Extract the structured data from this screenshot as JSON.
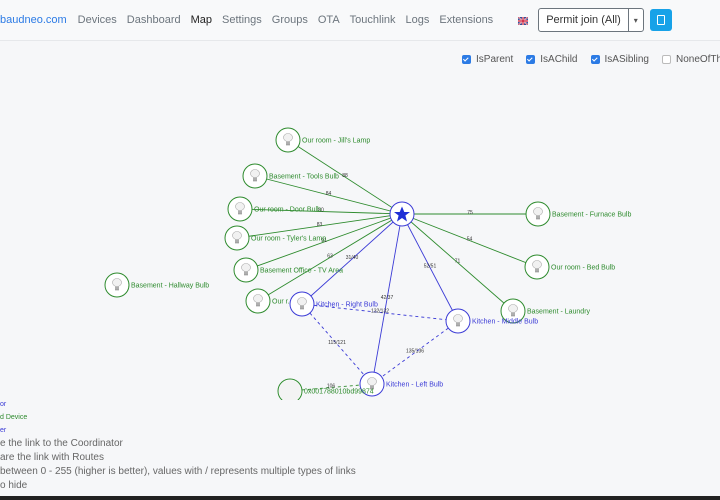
{
  "nav": {
    "brand": "baudneo.com",
    "links": [
      "Devices",
      "Dashboard",
      "Map",
      "Settings",
      "Groups",
      "OTA",
      "Touchlink",
      "Logs",
      "Extensions"
    ],
    "active": "Map",
    "permit_join_label": "Permit join (All)"
  },
  "filters": [
    {
      "label": "IsParent",
      "checked": true
    },
    {
      "label": "IsAChild",
      "checked": true
    },
    {
      "label": "IsASibling",
      "checked": true
    },
    {
      "label": "NoneOfTheAbove",
      "checked": false
    }
  ],
  "colors": {
    "green": "#2e8b2e",
    "blue": "#3b3bd6",
    "brand": "#2c7be5",
    "accent_button": "#17a2e8"
  },
  "map": {
    "coordinator": {
      "label": ""
    },
    "nodes": [
      {
        "id": "jills-lamp",
        "label": "Our room - Jill's Lamp",
        "color": "green",
        "icon": "bulb-icon"
      },
      {
        "id": "tools-bulb",
        "label": "Basement - Tools Bulb",
        "color": "green",
        "icon": "bulb-icon"
      },
      {
        "id": "door-bulb",
        "label": "Our room - Door Bulb",
        "color": "green",
        "icon": "bulb-icon"
      },
      {
        "id": "tylers-lamp",
        "label": "Our room - Tyler's Lamp",
        "color": "green",
        "icon": "bulb-icon"
      },
      {
        "id": "tv-area",
        "label": "Basement Office - TV Area",
        "color": "green",
        "icon": "bulb-icon"
      },
      {
        "id": "our-room-4",
        "label": "Our r...",
        "color": "green",
        "icon": "bulb-icon"
      },
      {
        "id": "hallway-bulb",
        "label": "Basement - Hallway Bulb",
        "color": "green",
        "icon": "bulb-icon"
      },
      {
        "id": "furnace-bulb",
        "label": "Basement - Furnace Bulb",
        "color": "green",
        "icon": "bulb-icon"
      },
      {
        "id": "bed-bulb",
        "label": "Our room - Bed Bulb",
        "color": "green",
        "icon": "bulb-icon"
      },
      {
        "id": "laundry",
        "label": "Basement - Laundry",
        "color": "green",
        "icon": "bulb-icon"
      },
      {
        "id": "right-bulb",
        "label": "Kitchen - Right Bulb",
        "color": "blue",
        "icon": "bulb-icon"
      },
      {
        "id": "middle-bulb",
        "label": "Kitchen - Middle Bulb",
        "color": "blue",
        "icon": "bulb-icon"
      },
      {
        "id": "left-bulb",
        "label": "Kitchen - Left Bulb",
        "color": "blue",
        "icon": "bulb-icon"
      },
      {
        "id": "unknown-device",
        "label": "0x001788010bd99874",
        "color": "green",
        "icon": "blank-icon"
      }
    ],
    "links": [
      {
        "from": "coordinator",
        "to": "jills-lamp",
        "label": "88",
        "color": "green",
        "dashed": false
      },
      {
        "from": "coordinator",
        "to": "tools-bulb",
        "label": "84",
        "color": "green",
        "dashed": false
      },
      {
        "from": "coordinator",
        "to": "door-bulb",
        "label": "80",
        "color": "green",
        "dashed": false
      },
      {
        "from": "coordinator",
        "to": "tylers-lamp",
        "label": "83",
        "color": "green",
        "dashed": false
      },
      {
        "from": "coordinator",
        "to": "tv-area",
        "label": "91",
        "color": "green",
        "dashed": false
      },
      {
        "from": "coordinator",
        "to": "our-room-4",
        "label": "63",
        "color": "green",
        "dashed": false
      },
      {
        "from": "coordinator",
        "to": "furnace-bulb",
        "label": "75",
        "color": "green",
        "dashed": false
      },
      {
        "from": "coordinator",
        "to": "bed-bulb",
        "label": "54",
        "color": "green",
        "dashed": false
      },
      {
        "from": "coordinator",
        "to": "laundry",
        "label": "71",
        "color": "green",
        "dashed": false
      },
      {
        "from": "coordinator",
        "to": "right-bulb",
        "label": "31/40",
        "color": "blue",
        "dashed": false
      },
      {
        "from": "coordinator",
        "to": "middle-bulb",
        "label": "52/51",
        "color": "blue",
        "dashed": false
      },
      {
        "from": "coordinator",
        "to": "left-bulb",
        "label": "42/37",
        "color": "blue",
        "dashed": false
      },
      {
        "from": "right-bulb",
        "to": "middle-bulb",
        "label": "132/132",
        "color": "blue",
        "dashed": true
      },
      {
        "from": "right-bulb",
        "to": "left-bulb",
        "label": "115/121",
        "color": "blue",
        "dashed": true
      },
      {
        "from": "middle-bulb",
        "to": "left-bulb",
        "label": "135/136",
        "color": "blue",
        "dashed": true
      },
      {
        "from": "unknown-device",
        "to": "left-bulb",
        "label": "106",
        "color": "green",
        "dashed": true
      }
    ]
  },
  "legend": {
    "coordinator": "or",
    "end_device": "d Device",
    "router": "er",
    "line1": "e the link to the Coordinator",
    "line2": "are the link with Routes",
    "line3": "between 0 - 255 (higher is better), values with / represents multiple types of links",
    "line4": "o hide"
  }
}
